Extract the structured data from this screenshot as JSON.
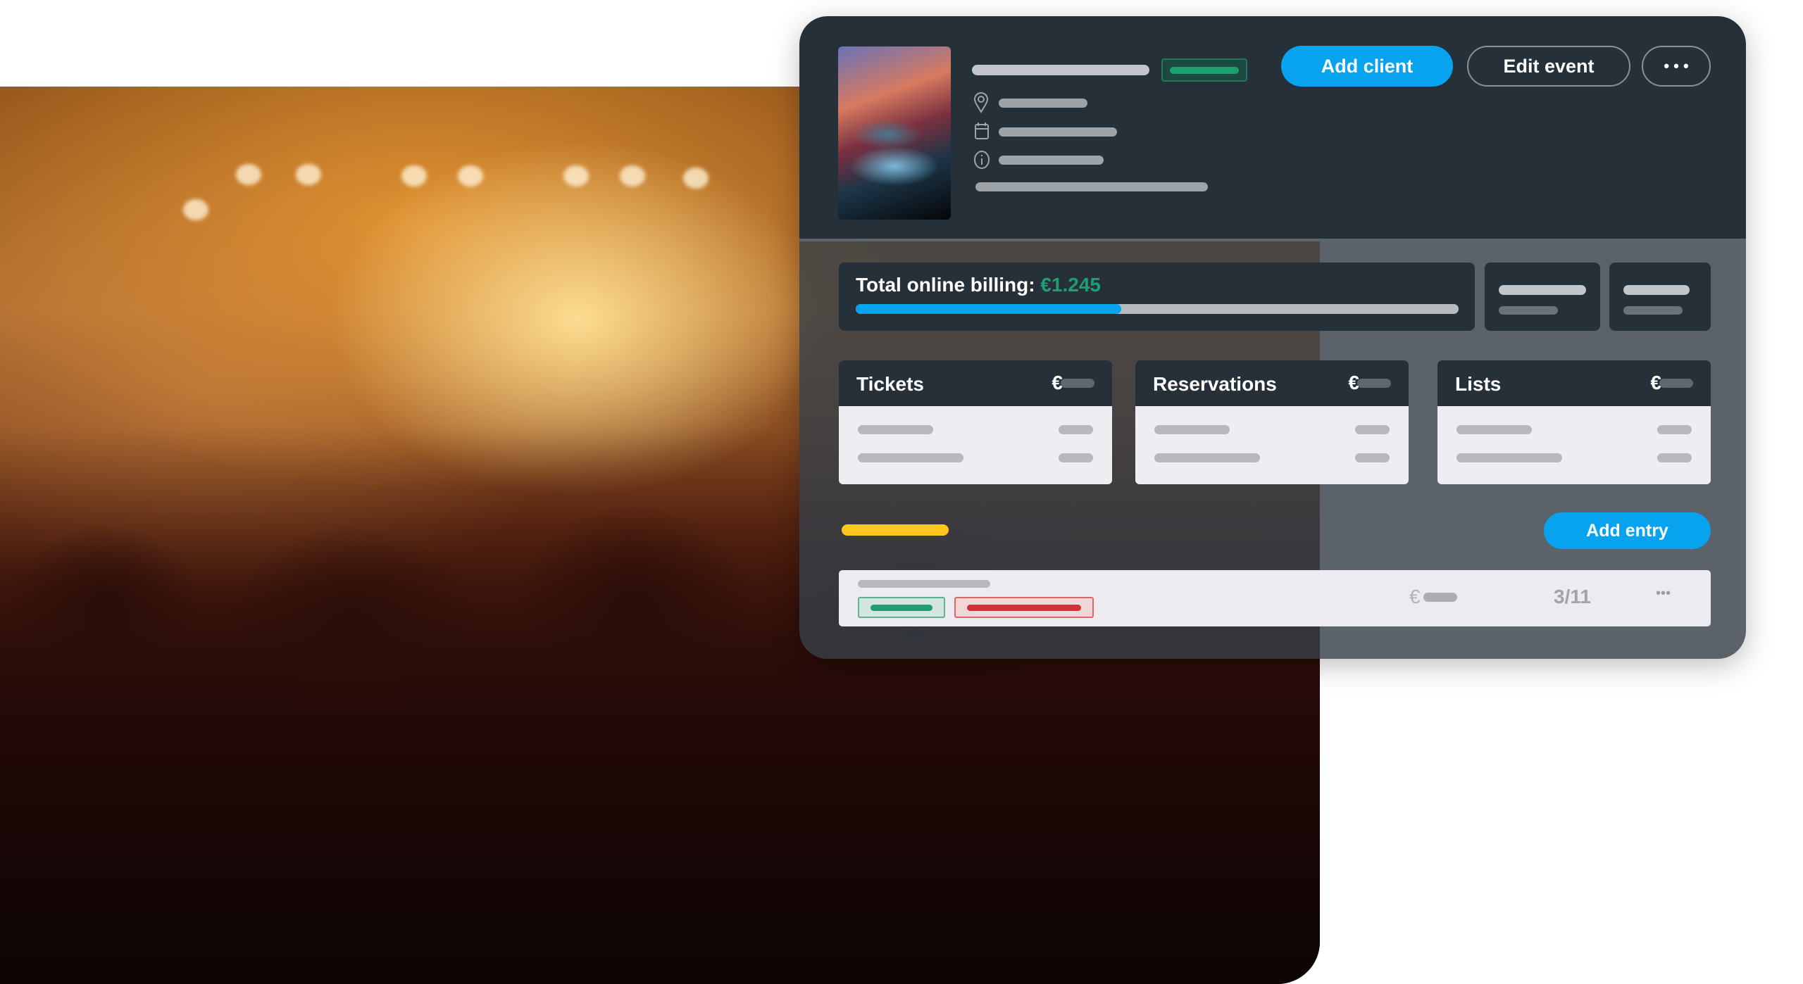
{
  "event": {
    "thumbnail": "dj-mixer-image",
    "icons": [
      "location-pin-icon",
      "calendar-icon",
      "info-icon"
    ]
  },
  "header": {
    "add_client": "Add client",
    "edit_event": "Edit event",
    "more": "• • •"
  },
  "billing": {
    "label": "Total online billing: ",
    "amount": "€1.245",
    "progress_percent": 44
  },
  "cards": [
    {
      "title": "Tickets",
      "currency": "€"
    },
    {
      "title": "Reservations",
      "currency": "€"
    },
    {
      "title": "Lists",
      "currency": "€"
    }
  ],
  "add_entry": "Add entry",
  "entry": {
    "currency": "€",
    "count": "3/11",
    "more": "•••"
  },
  "colors": {
    "accent": "#08a3ef",
    "green": "#1f9e72",
    "red": "#d32f34",
    "yellow": "#ffc61f",
    "panel": "#263038"
  }
}
